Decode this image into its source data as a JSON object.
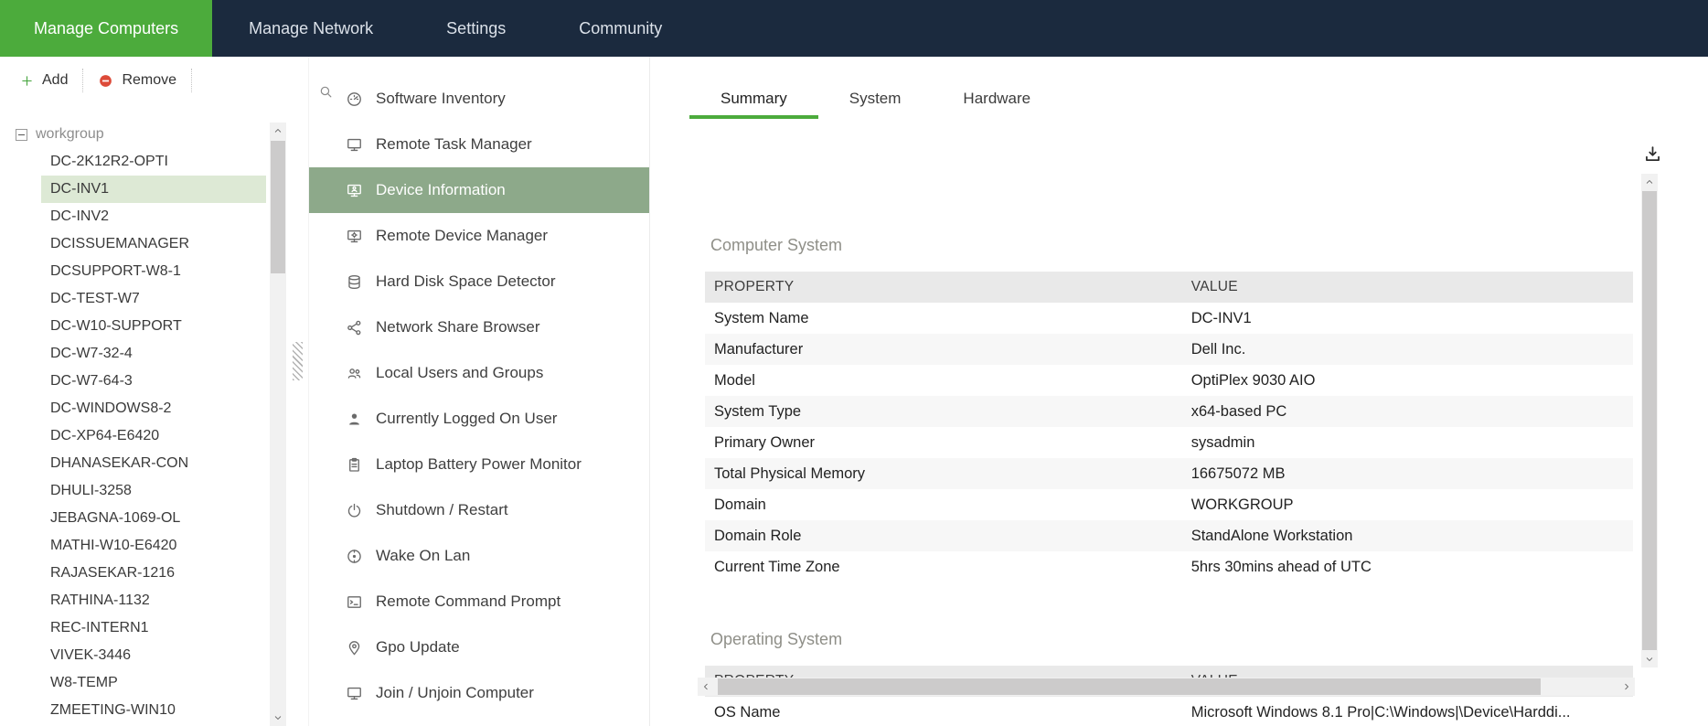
{
  "colors": {
    "nav_background": "#1b2a3e",
    "accent_green": "#4cab3c",
    "selected_tool_background": "#8da98a",
    "selected_tree_background": "#dde9d5",
    "remove_red": "#dd4b39"
  },
  "topnav": {
    "items": [
      {
        "label": "Manage Computers",
        "active": true
      },
      {
        "label": "Manage Network",
        "active": false
      },
      {
        "label": "Settings",
        "active": false
      },
      {
        "label": "Community",
        "active": false
      }
    ]
  },
  "sidebar": {
    "toolbar": {
      "add_label": "Add",
      "remove_label": "Remove"
    },
    "tree": {
      "root": "workgroup",
      "selected": "DC-INV1",
      "computers": [
        "DC-2K12R2-OPTI",
        "DC-INV1",
        "DC-INV2",
        "DCISSUEMANAGER",
        "DCSUPPORT-W8-1",
        "DC-TEST-W7",
        "DC-W10-SUPPORT",
        "DC-W7-32-4",
        "DC-W7-64-3",
        "DC-WINDOWS8-2",
        "DC-XP64-E6420",
        "DHANASEKAR-CON",
        "DHULI-3258",
        "JEBAGNA-1069-OL",
        "MATHI-W10-E6420",
        "RAJASEKAR-1216",
        "RATHINA-1132",
        "REC-INTERN1",
        "VIVEK-3446",
        "W8-TEMP",
        "ZMEETING-WIN10"
      ]
    }
  },
  "tools": {
    "selected": "Device Information",
    "items": [
      {
        "label": "Software Inventory",
        "icon": "gauge-icon"
      },
      {
        "label": "Remote Task Manager",
        "icon": "monitor-icon"
      },
      {
        "label": "Device Information",
        "icon": "monitor-user-icon"
      },
      {
        "label": "Remote Device Manager",
        "icon": "monitor-gear-icon"
      },
      {
        "label": "Hard Disk Space Detector",
        "icon": "hard-disk-icon"
      },
      {
        "label": "Network Share Browser",
        "icon": "network-share-icon"
      },
      {
        "label": "Local Users and Groups",
        "icon": "users-group-icon"
      },
      {
        "label": "Currently Logged On User",
        "icon": "user-icon"
      },
      {
        "label": "Laptop Battery Power Monitor",
        "icon": "clipboard-icon"
      },
      {
        "label": "Shutdown / Restart",
        "icon": "power-icon"
      },
      {
        "label": "Wake On Lan",
        "icon": "wake-disc-icon"
      },
      {
        "label": "Remote Command Prompt",
        "icon": "command-prompt-icon"
      },
      {
        "label": "Gpo Update",
        "icon": "location-pin-icon"
      },
      {
        "label": "Join / Unjoin Computer",
        "icon": "monitor-icon"
      }
    ]
  },
  "content": {
    "tabs": [
      {
        "label": "Summary",
        "active": true
      },
      {
        "label": "System",
        "active": false
      },
      {
        "label": "Hardware",
        "active": false
      }
    ],
    "sections": [
      {
        "title": "Computer System",
        "columns": [
          "PROPERTY",
          "VALUE"
        ],
        "rows": [
          [
            "System Name",
            "DC-INV1"
          ],
          [
            "Manufacturer",
            "Dell Inc."
          ],
          [
            "Model",
            "OptiPlex 9030 AIO"
          ],
          [
            "System Type",
            "x64-based PC"
          ],
          [
            "Primary Owner",
            "sysadmin"
          ],
          [
            "Total Physical Memory",
            "16675072 MB"
          ],
          [
            "Domain",
            "WORKGROUP"
          ],
          [
            "Domain Role",
            "StandAlone Workstation"
          ],
          [
            "Current Time Zone",
            "5hrs 30mins ahead of UTC"
          ]
        ]
      },
      {
        "title": "Operating System",
        "columns": [
          "PROPERTY",
          "VALUE"
        ],
        "rows": [
          [
            "OS Name",
            "Microsoft Windows 8.1 Pro|C:\\Windows|\\Device\\Harddi..."
          ]
        ]
      }
    ]
  }
}
